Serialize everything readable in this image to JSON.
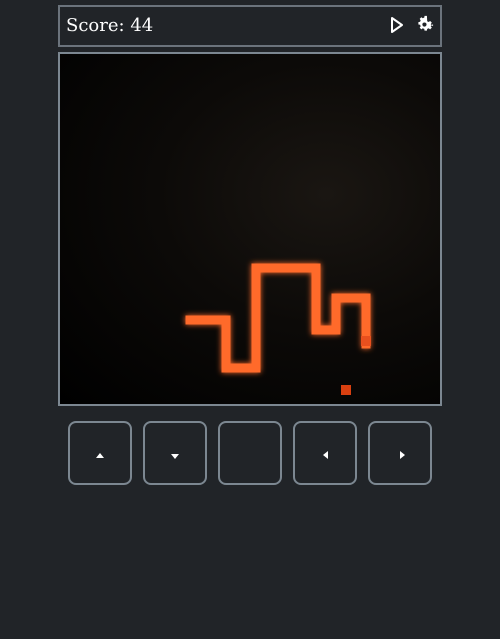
{
  "header": {
    "score_label": "Score:",
    "score_value": "44",
    "play_icon": "play-icon",
    "settings_icon": "gear-icon"
  },
  "game": {
    "snake_color": "#ff6b2b",
    "food_color": "#d94010",
    "cell_unit": 1
  },
  "controls": [
    {
      "name": "up-button",
      "icon": "arrow-up-icon"
    },
    {
      "name": "down-button",
      "icon": "arrow-down-icon"
    },
    {
      "name": "center-button",
      "icon": ""
    },
    {
      "name": "left-button",
      "icon": "arrow-left-icon"
    },
    {
      "name": "right-button",
      "icon": "arrow-right-icon"
    }
  ],
  "colors": {
    "background": "#212428",
    "border": "#7c8791",
    "text": "#ffffff"
  }
}
